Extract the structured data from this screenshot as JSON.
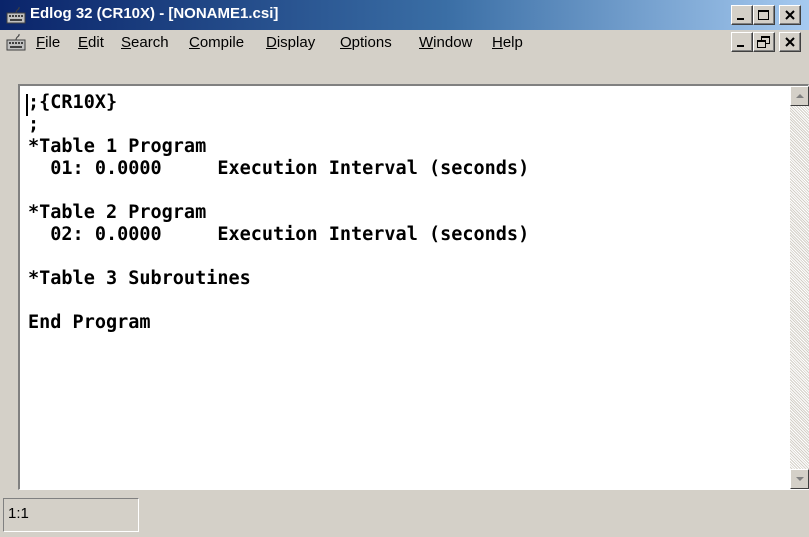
{
  "window": {
    "title": "Edlog 32 (CR10X) - [NONAME1.csi]"
  },
  "menu": {
    "items": [
      {
        "label": "File"
      },
      {
        "label": "Edit"
      },
      {
        "label": "Search"
      },
      {
        "label": "Compile"
      },
      {
        "label": "Display"
      },
      {
        "label": "Options"
      },
      {
        "label": "Window"
      },
      {
        "label": "Help"
      }
    ]
  },
  "editor": {
    "lines": [
      ";{CR10X}",
      ";",
      "*Table 1 Program",
      "  01: 0.0000     Execution Interval (seconds)",
      "",
      "*Table 2 Program",
      "  02: 0.0000     Execution Interval (seconds)",
      "",
      "*Table 3 Subroutines",
      "",
      "End Program"
    ]
  },
  "status": {
    "position": "1:1"
  },
  "icons": {
    "app": "keyboard-icon",
    "doc": "keyboard-icon",
    "minimize": "minimize-icon",
    "maximize": "maximize-icon",
    "close": "close-icon",
    "restore": "restore-icon",
    "scroll_up": "arrow-up-icon",
    "scroll_down": "arrow-down-icon"
  }
}
